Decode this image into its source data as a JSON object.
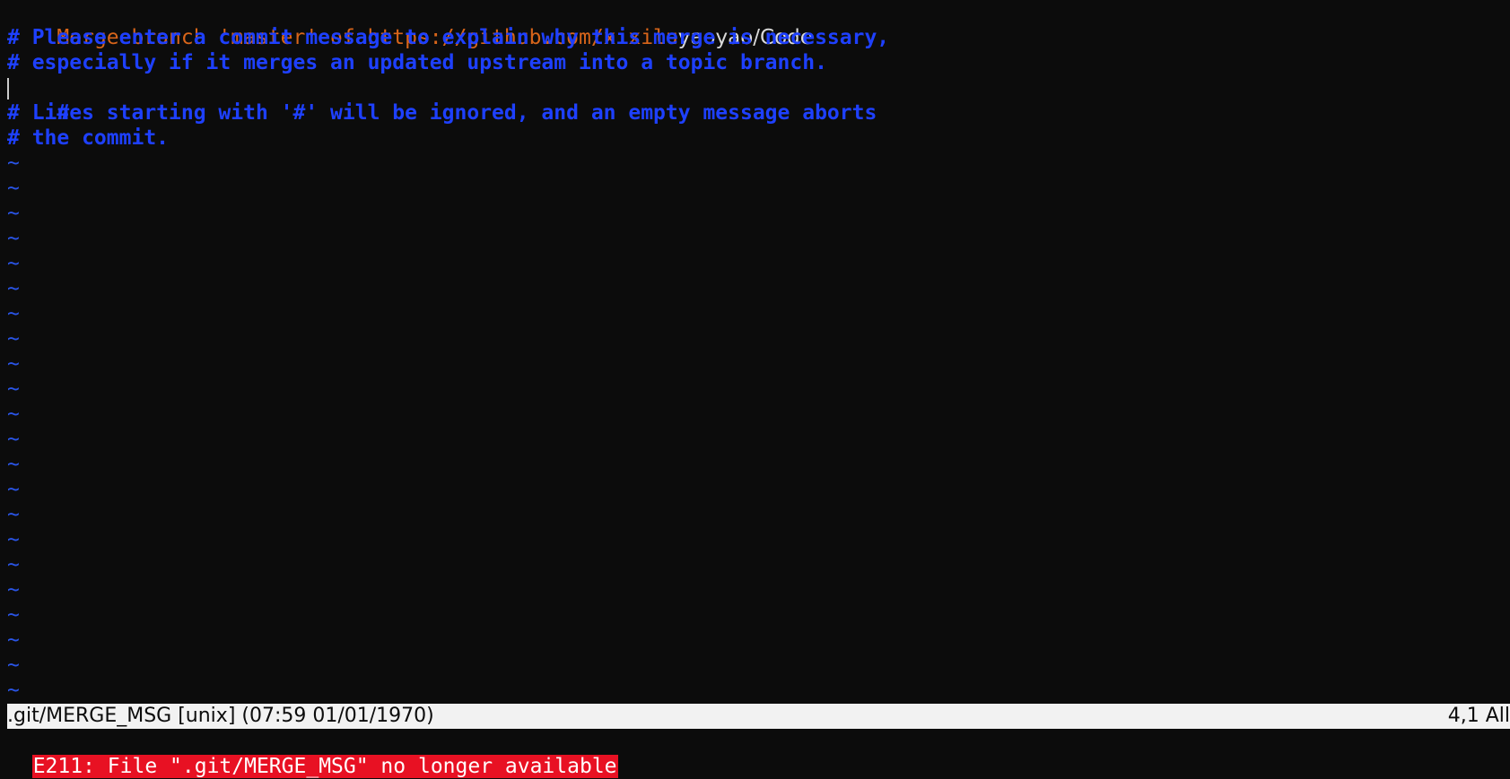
{
  "editor": {
    "merge_line_prefix": "Merge branch 'master' of https://github.com/xixilu",
    "merge_line_suffix": "yaoyao/Code",
    "comment_lines": [
      "# Please enter a commit message to explain why this merge is necessary,",
      "# especially if it merges an updated upstream into a topic branch.",
      "#",
      "# Lines starting with '#' will be ignored, and an empty message aborts",
      "# the commit."
    ],
    "empty_line_marker": "~",
    "empty_line_count": 22
  },
  "statusbar": {
    "file_info": ".git/MERGE_MSG [unix] (07:59 01/01/1970)",
    "position": "4,1 All"
  },
  "message": {
    "error": "E211: File \".git/MERGE_MSG\" no longer available"
  },
  "colors": {
    "background": "#0c0c0c",
    "merge_text": "#d8651a",
    "comment_text": "#1e40ff",
    "tilde": "#2a55e8",
    "statusbar_bg": "#f2f2f2",
    "error_bg": "#e81123"
  }
}
